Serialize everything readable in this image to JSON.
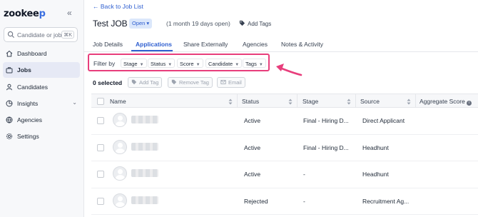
{
  "sidebar": {
    "logo": {
      "main": "zookee",
      "accent": "p"
    },
    "search": {
      "placeholder": "Candidate or job",
      "shortcut": "⌘K"
    },
    "items": [
      {
        "label": "Dashboard",
        "icon": "home-icon"
      },
      {
        "label": "Jobs",
        "icon": "briefcase-icon",
        "active": true
      },
      {
        "label": "Candidates",
        "icon": "user-icon"
      },
      {
        "label": "Insights",
        "icon": "chart-icon",
        "expandable": true
      },
      {
        "label": "Agencies",
        "icon": "building-icon"
      },
      {
        "label": "Settings",
        "icon": "gear-icon"
      }
    ]
  },
  "header": {
    "back_link": "← Back to Job List",
    "title": "Test JOB",
    "status": "Open ▾",
    "duration": "(1 month 19 days open)",
    "add_tags": "Add Tags"
  },
  "tabs": [
    "Job Details",
    "Applications",
    "Share Externally",
    "Agencies",
    "Notes & Activity"
  ],
  "active_tab": "Applications",
  "filters": {
    "label": "Filter by",
    "chips": [
      "Stage",
      "Status",
      "Score",
      "Candidate",
      "Tags"
    ]
  },
  "bulk_actions": {
    "selected": "0 selected",
    "buttons": [
      "Add Tag",
      "Remove Tag",
      "Email"
    ]
  },
  "table": {
    "columns": [
      "Name",
      "Status",
      "Stage",
      "Source",
      "Aggregate Score"
    ],
    "rows": [
      {
        "status": "Active",
        "stage": "Final - Hiring D...",
        "source": "Direct Applicant"
      },
      {
        "status": "Active",
        "stage": "Final - Hiring D...",
        "source": "Headhunt"
      },
      {
        "status": "Active",
        "stage": "-",
        "source": "Headhunt"
      },
      {
        "status": "Rejected",
        "stage": "-",
        "source": "Recruitment Ag..."
      }
    ]
  },
  "colors": {
    "accent": "#2f5fd0",
    "highlight": "#e83e7c",
    "sidebar_bg": "#f7f8fa"
  }
}
